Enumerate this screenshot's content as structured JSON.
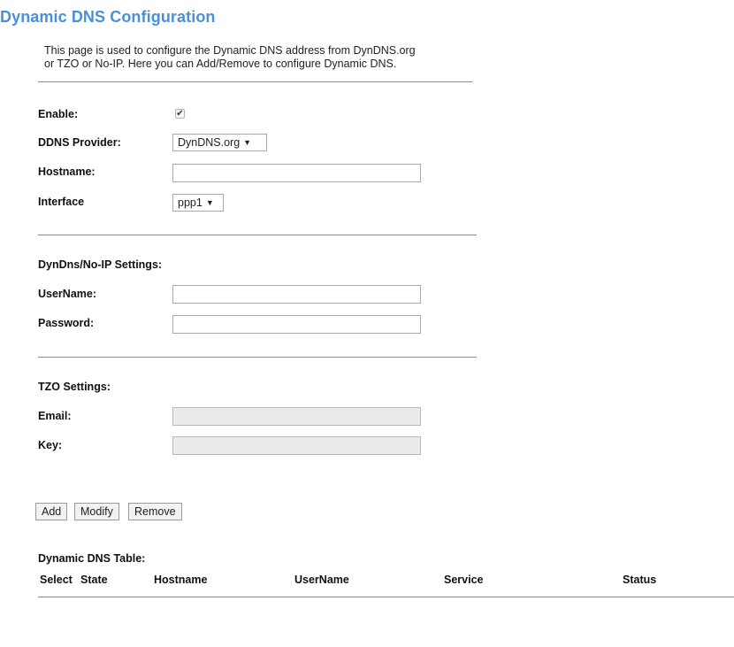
{
  "page": {
    "title": "Dynamic DNS Configuration",
    "description_line1": "This page is used to configure the Dynamic DNS address from DynDNS.org",
    "description_line2": "or TZO or No-IP. Here you can Add/Remove to configure Dynamic DNS."
  },
  "general": {
    "enable_label": "Enable:",
    "enable_checked": true,
    "provider_label": "DDNS Provider:",
    "provider_value": "DynDNS.org",
    "hostname_label": "Hostname:",
    "hostname_value": "",
    "interface_label": "Interface",
    "interface_value": "ppp1"
  },
  "dyndns": {
    "section_label": "DynDns/No-IP Settings:",
    "username_label": "UserName:",
    "username_value": "",
    "password_label": "Password:",
    "password_value": ""
  },
  "tzo": {
    "section_label": "TZO Settings:",
    "email_label": "Email:",
    "email_value": "",
    "key_label": "Key:",
    "key_value": ""
  },
  "actions": {
    "add_label": "Add",
    "modify_label": "Modify",
    "remove_label": "Remove"
  },
  "table": {
    "title": "Dynamic DNS Table:",
    "columns": [
      "Select",
      "State",
      "Hostname",
      "UserName",
      "Service",
      "Status"
    ]
  },
  "colors": {
    "title": "#4a90d9"
  }
}
